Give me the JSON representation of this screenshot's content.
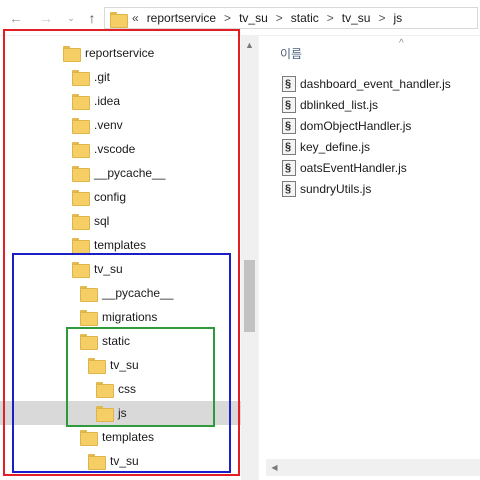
{
  "nav": {
    "back_glyph": "←",
    "forward_glyph": "→",
    "recent_glyph": "⌄",
    "up_glyph": "↑"
  },
  "address": {
    "overflow": "«",
    "crumbs": [
      "reportservice",
      "tv_su",
      "static",
      "tv_su",
      "js"
    ],
    "separator": ">"
  },
  "tree": {
    "items": [
      {
        "label": "reportservice"
      },
      {
        "label": ".git"
      },
      {
        "label": ".idea"
      },
      {
        "label": ".venv"
      },
      {
        "label": ".vscode"
      },
      {
        "label": "__pycache__"
      },
      {
        "label": "config"
      },
      {
        "label": "sql"
      },
      {
        "label": "templates"
      },
      {
        "label": "tv_su"
      },
      {
        "label": "__pycache__"
      },
      {
        "label": "migrations"
      },
      {
        "label": "static"
      },
      {
        "label": "tv_su"
      },
      {
        "label": "css"
      },
      {
        "label": "js"
      },
      {
        "label": "templates"
      },
      {
        "label": "tv_su"
      }
    ],
    "selected_label": "js"
  },
  "files": {
    "column_header": "이름",
    "sort_glyph": "^",
    "items": [
      {
        "name": "dashboard_event_handler.js"
      },
      {
        "name": "dblinked_list.js"
      },
      {
        "name": "domObjectHandler.js"
      },
      {
        "name": "key_define.js"
      },
      {
        "name": "oatsEventHandler.js"
      },
      {
        "name": "sundryUtils.js"
      }
    ]
  },
  "colors": {
    "red_box": "#e31e24",
    "blue_box": "#1c1ec8",
    "green_box": "#2e9a3b",
    "folder": "#f5cf66",
    "selection": "#d9d9d9"
  }
}
